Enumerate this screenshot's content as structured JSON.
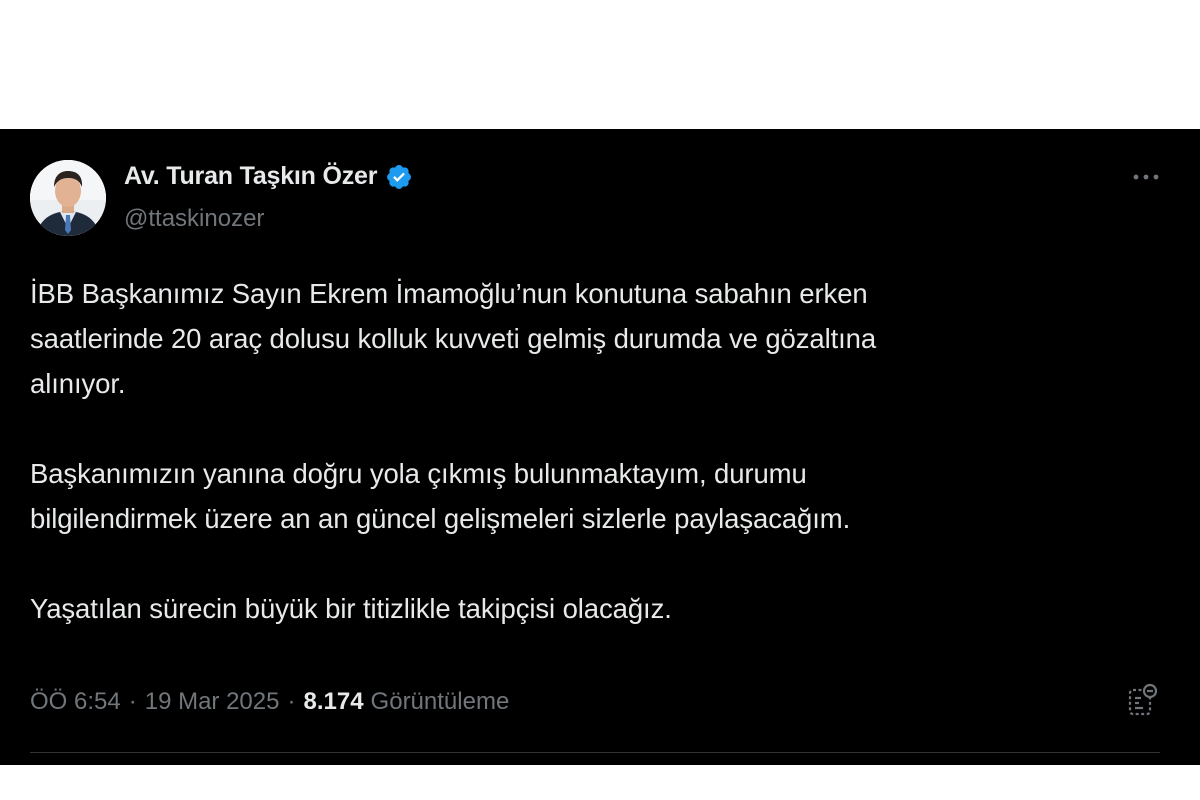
{
  "author": {
    "display_name": "Av. Turan Taşkın Özer",
    "handle": "@ttaskinozer",
    "verified": true,
    "avatar_icon": "person-photo"
  },
  "tweet": {
    "paragraphs": [
      "İBB Başkanımız Sayın Ekrem İmamoğlu’nun konutuna sabahın erken\nsaatlerinde 20 araç dolusu kolluk kuvveti gelmiş durumda ve gözaltına\nalınıyor.",
      "Başkanımızın yanına doğru yola çıkmış bulunmaktayım, durumu\nbilgilendirmek üzere an an güncel gelişmeleri sizlerle paylaşacağım.",
      "Yaşatılan sürecin büyük bir titizlikle takipçisi olacağız."
    ]
  },
  "meta": {
    "time": "ÖÖ 6:54",
    "separator": "·",
    "date": "19 Mar 2025",
    "views_count": "8.174",
    "views_label": "Görüntüleme"
  },
  "icons": {
    "more": "more-horizontal-icon",
    "analytics": "analytics-icon",
    "verified": "verified-badge-icon"
  },
  "colors": {
    "background": "#000000",
    "text_primary": "#e7e9ea",
    "text_secondary": "#71767b",
    "verified_blue": "#1d9bf0",
    "divider": "#2f3336"
  }
}
